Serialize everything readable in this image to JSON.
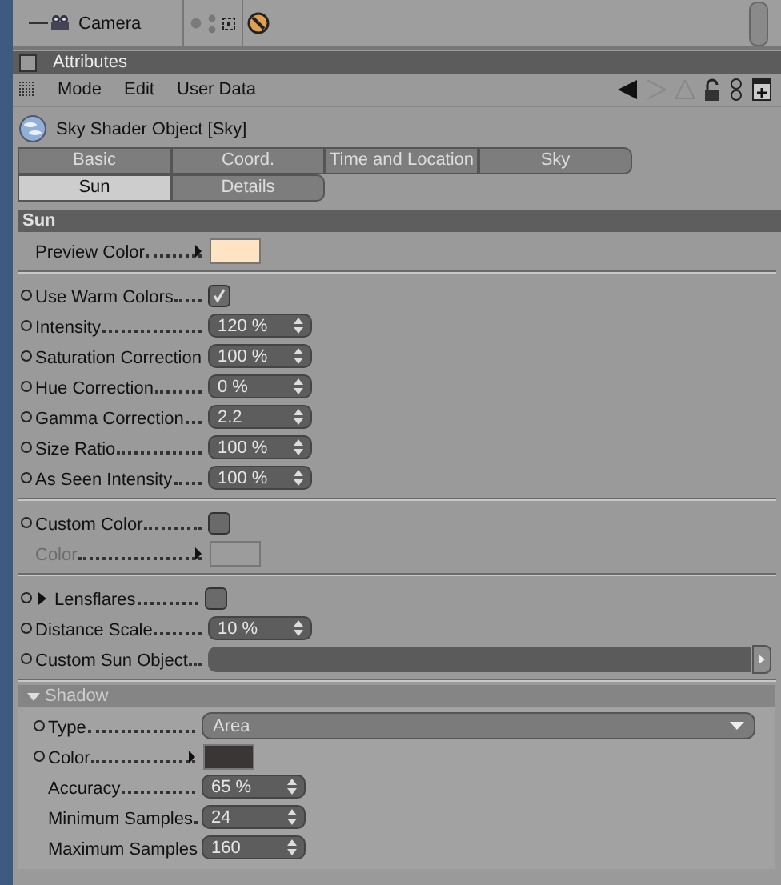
{
  "object_manager": {
    "item": "Camera"
  },
  "panel": {
    "title": "Attributes",
    "menu": [
      "Mode",
      "Edit",
      "User Data"
    ],
    "object_title": "Sky Shader Object [Sky]"
  },
  "tab_rows": [
    [
      {
        "label": "Basic",
        "selected": false
      },
      {
        "label": "Coord.",
        "selected": false
      },
      {
        "label": "Time and Location",
        "selected": false
      },
      {
        "label": "Sky",
        "selected": false
      }
    ],
    [
      {
        "label": "Sun",
        "selected": true
      },
      {
        "label": "Details",
        "selected": false
      }
    ]
  ],
  "section": "Sun",
  "groups": [
    {
      "rows": [
        {
          "kind": "color",
          "label": "Preview Color",
          "animatable": false,
          "disabled": false,
          "color": "#ffe4c4"
        }
      ]
    },
    {
      "rows": [
        {
          "kind": "checkbox",
          "label": "Use Warm Colors",
          "animatable": true,
          "disabled": false,
          "checked": true
        },
        {
          "kind": "number",
          "label": "Intensity",
          "animatable": true,
          "disabled": false,
          "value": "120 %"
        },
        {
          "kind": "number",
          "label": "Saturation Correction",
          "animatable": true,
          "disabled": false,
          "value": "100 %"
        },
        {
          "kind": "number",
          "label": "Hue Correction",
          "animatable": true,
          "disabled": false,
          "value": "0 %"
        },
        {
          "kind": "number",
          "label": "Gamma Correction",
          "animatable": true,
          "disabled": false,
          "value": "2.2"
        },
        {
          "kind": "number",
          "label": "Size Ratio",
          "animatable": true,
          "disabled": false,
          "value": "100 %"
        },
        {
          "kind": "number",
          "label": "As Seen Intensity",
          "animatable": true,
          "disabled": false,
          "value": "100 %"
        }
      ]
    },
    {
      "rows": [
        {
          "kind": "checkbox",
          "label": "Custom Color",
          "animatable": true,
          "disabled": false,
          "checked": false
        },
        {
          "kind": "color",
          "label": "Color",
          "animatable": false,
          "disabled": true,
          "color": "#9c9c9c"
        }
      ]
    },
    {
      "rows": [
        {
          "kind": "checkbox",
          "label": "Lensflares",
          "animatable": true,
          "disabled": false,
          "expanded": false,
          "checked": false
        },
        {
          "kind": "number",
          "label": "Distance Scale",
          "animatable": true,
          "disabled": false,
          "value": "10 %"
        },
        {
          "kind": "link",
          "label": "Custom Sun Object",
          "animatable": true,
          "disabled": false
        }
      ]
    }
  ],
  "subgroup": {
    "title": "Shadow",
    "expanded": true,
    "rows": [
      {
        "kind": "dropdown",
        "label": "Type",
        "animatable": true,
        "disabled": false,
        "value": "Area"
      },
      {
        "kind": "color",
        "label": "Color",
        "animatable": true,
        "disabled": false,
        "color": "#3a3636"
      },
      {
        "kind": "number",
        "label": "Accuracy",
        "animatable": false,
        "disabled": false,
        "value": "65 %"
      },
      {
        "kind": "number",
        "label": "Minimum Samples",
        "animatable": false,
        "disabled": false,
        "value": "24"
      },
      {
        "kind": "number",
        "label": "Maximum Samples",
        "animatable": false,
        "disabled": false,
        "value": "160"
      }
    ]
  }
}
